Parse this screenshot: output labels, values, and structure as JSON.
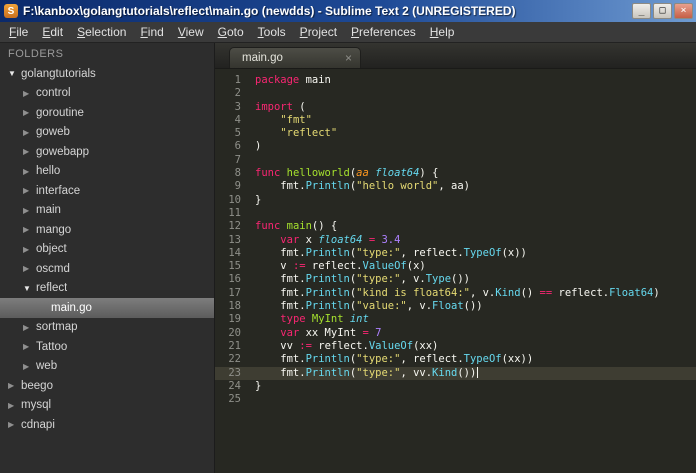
{
  "window": {
    "title": "F:\\kanbox\\golangtutorials\\reflect\\main.go (newdds) - Sublime Text 2 (UNREGISTERED)",
    "icon": "S",
    "controls": {
      "minimize": "_",
      "maximize": "□",
      "close": "×"
    }
  },
  "menu": {
    "items": [
      "File",
      "Edit",
      "Selection",
      "Find",
      "View",
      "Goto",
      "Tools",
      "Project",
      "Preferences",
      "Help"
    ]
  },
  "sidebar": {
    "header": "FOLDERS",
    "items": [
      {
        "label": "golangtutorials",
        "depth": 0,
        "state": "expanded",
        "selected": false
      },
      {
        "label": "control",
        "depth": 1,
        "state": "collapsed",
        "selected": false
      },
      {
        "label": "goroutine",
        "depth": 1,
        "state": "collapsed",
        "selected": false
      },
      {
        "label": "goweb",
        "depth": 1,
        "state": "collapsed",
        "selected": false
      },
      {
        "label": "gowebapp",
        "depth": 1,
        "state": "collapsed",
        "selected": false
      },
      {
        "label": "hello",
        "depth": 1,
        "state": "collapsed",
        "selected": false
      },
      {
        "label": "interface",
        "depth": 1,
        "state": "collapsed",
        "selected": false
      },
      {
        "label": "main",
        "depth": 1,
        "state": "collapsed",
        "selected": false
      },
      {
        "label": "mango",
        "depth": 1,
        "state": "collapsed",
        "selected": false
      },
      {
        "label": "object",
        "depth": 1,
        "state": "collapsed",
        "selected": false
      },
      {
        "label": "oscmd",
        "depth": 1,
        "state": "collapsed",
        "selected": false
      },
      {
        "label": "reflect",
        "depth": 1,
        "state": "expanded",
        "selected": false
      },
      {
        "label": "main.go",
        "depth": 2,
        "state": "file",
        "selected": true
      },
      {
        "label": "sortmap",
        "depth": 1,
        "state": "collapsed",
        "selected": false
      },
      {
        "label": "Tattoo",
        "depth": 1,
        "state": "collapsed",
        "selected": false
      },
      {
        "label": "web",
        "depth": 1,
        "state": "collapsed",
        "selected": false
      },
      {
        "label": "beego",
        "depth": 0,
        "state": "collapsed",
        "selected": false
      },
      {
        "label": "mysql",
        "depth": 0,
        "state": "collapsed",
        "selected": false
      },
      {
        "label": "cdnapi",
        "depth": 0,
        "state": "collapsed",
        "selected": false
      }
    ]
  },
  "tabbar": {
    "tabs": [
      {
        "label": "main.go",
        "close": "×",
        "active": true
      }
    ]
  },
  "editor": {
    "active_line": 23,
    "lines": [
      {
        "n": 1,
        "seg": [
          [
            "k",
            "package"
          ],
          [
            "w",
            " main"
          ]
        ]
      },
      {
        "n": 2,
        "seg": []
      },
      {
        "n": 3,
        "seg": [
          [
            "k",
            "import"
          ],
          [
            "w",
            " ("
          ]
        ]
      },
      {
        "n": 4,
        "seg": [
          [
            "w",
            "    "
          ],
          [
            "s",
            "\"fmt\""
          ]
        ]
      },
      {
        "n": 5,
        "seg": [
          [
            "w",
            "    "
          ],
          [
            "s",
            "\"reflect\""
          ]
        ]
      },
      {
        "n": 6,
        "seg": [
          [
            "w",
            ")"
          ]
        ]
      },
      {
        "n": 7,
        "seg": []
      },
      {
        "n": 8,
        "seg": [
          [
            "k",
            "func"
          ],
          [
            "w",
            " "
          ],
          [
            "g",
            "helloworld"
          ],
          [
            "w",
            "("
          ],
          [
            "p",
            "aa"
          ],
          [
            "w",
            " "
          ],
          [
            "t",
            "float64"
          ],
          [
            "w",
            ") {"
          ]
        ]
      },
      {
        "n": 9,
        "seg": [
          [
            "w",
            "    fmt."
          ],
          [
            "f",
            "Println"
          ],
          [
            "w",
            "("
          ],
          [
            "s",
            "\"hello world\""
          ],
          [
            "w",
            ", aa)"
          ]
        ]
      },
      {
        "n": 10,
        "seg": [
          [
            "w",
            "}"
          ]
        ]
      },
      {
        "n": 11,
        "seg": []
      },
      {
        "n": 12,
        "seg": [
          [
            "k",
            "func"
          ],
          [
            "w",
            " "
          ],
          [
            "g",
            "main"
          ],
          [
            "w",
            "() {"
          ]
        ]
      },
      {
        "n": 13,
        "seg": [
          [
            "w",
            "    "
          ],
          [
            "k",
            "var"
          ],
          [
            "w",
            " x "
          ],
          [
            "t",
            "float64"
          ],
          [
            "w",
            " "
          ],
          [
            "k",
            "="
          ],
          [
            "w",
            " "
          ],
          [
            "n",
            "3.4"
          ]
        ]
      },
      {
        "n": 14,
        "seg": [
          [
            "w",
            "    fmt."
          ],
          [
            "f",
            "Println"
          ],
          [
            "w",
            "("
          ],
          [
            "s",
            "\"type:\""
          ],
          [
            "w",
            ", reflect."
          ],
          [
            "f",
            "TypeOf"
          ],
          [
            "w",
            "(x))"
          ]
        ]
      },
      {
        "n": 15,
        "seg": [
          [
            "w",
            "    v "
          ],
          [
            "k",
            ":="
          ],
          [
            "w",
            " reflect."
          ],
          [
            "f",
            "ValueOf"
          ],
          [
            "w",
            "(x)"
          ]
        ]
      },
      {
        "n": 16,
        "seg": [
          [
            "w",
            "    fmt."
          ],
          [
            "f",
            "Println"
          ],
          [
            "w",
            "("
          ],
          [
            "s",
            "\"type:\""
          ],
          [
            "w",
            ", v."
          ],
          [
            "f",
            "Type"
          ],
          [
            "w",
            "())"
          ]
        ]
      },
      {
        "n": 17,
        "seg": [
          [
            "w",
            "    fmt."
          ],
          [
            "f",
            "Println"
          ],
          [
            "w",
            "("
          ],
          [
            "s",
            "\"kind is float64:\""
          ],
          [
            "w",
            ", v."
          ],
          [
            "f",
            "Kind"
          ],
          [
            "w",
            "() "
          ],
          [
            "k",
            "=="
          ],
          [
            "w",
            " reflect."
          ],
          [
            "f",
            "Float64"
          ],
          [
            "w",
            ")"
          ]
        ]
      },
      {
        "n": 18,
        "seg": [
          [
            "w",
            "    fmt."
          ],
          [
            "f",
            "Println"
          ],
          [
            "w",
            "("
          ],
          [
            "s",
            "\"value:\""
          ],
          [
            "w",
            ", v."
          ],
          [
            "f",
            "Float"
          ],
          [
            "w",
            "())"
          ]
        ]
      },
      {
        "n": 19,
        "seg": [
          [
            "w",
            "    "
          ],
          [
            "k",
            "type"
          ],
          [
            "w",
            " "
          ],
          [
            "g",
            "MyInt"
          ],
          [
            "w",
            " "
          ],
          [
            "t",
            "int"
          ]
        ]
      },
      {
        "n": 20,
        "seg": [
          [
            "w",
            "    "
          ],
          [
            "k",
            "var"
          ],
          [
            "w",
            " xx MyInt "
          ],
          [
            "k",
            "="
          ],
          [
            "w",
            " "
          ],
          [
            "n",
            "7"
          ]
        ]
      },
      {
        "n": 21,
        "seg": [
          [
            "w",
            "    vv "
          ],
          [
            "k",
            ":="
          ],
          [
            "w",
            " reflect."
          ],
          [
            "f",
            "ValueOf"
          ],
          [
            "w",
            "(xx)"
          ]
        ]
      },
      {
        "n": 22,
        "seg": [
          [
            "w",
            "    fmt."
          ],
          [
            "f",
            "Println"
          ],
          [
            "w",
            "("
          ],
          [
            "s",
            "\"type:\""
          ],
          [
            "w",
            ", reflect."
          ],
          [
            "f",
            "TypeOf"
          ],
          [
            "w",
            "(xx))"
          ]
        ]
      },
      {
        "n": 23,
        "seg": [
          [
            "w",
            "    fmt."
          ],
          [
            "f",
            "Println"
          ],
          [
            "w",
            "("
          ],
          [
            "s",
            "\"type:\""
          ],
          [
            "w",
            ", vv."
          ],
          [
            "f",
            "Kind"
          ],
          [
            "w",
            "())"
          ]
        ]
      },
      {
        "n": 24,
        "seg": [
          [
            "w",
            "}"
          ]
        ]
      },
      {
        "n": 25,
        "seg": []
      }
    ]
  },
  "colors": {
    "titlebar_left": "#0b2a6b",
    "titlebar_right": "#6f9bd2",
    "editor_bg": "#272822",
    "line_highlight": "#3e3d32",
    "gutter": "#8f908a",
    "keyword": "#f92672",
    "string": "#e6db74",
    "number": "#ae81ff",
    "function": "#66d9ef",
    "type": "#66d9ef",
    "declaration_name": "#a6e22e",
    "parameter": "#fd971f",
    "text": "#f8f8f2"
  }
}
